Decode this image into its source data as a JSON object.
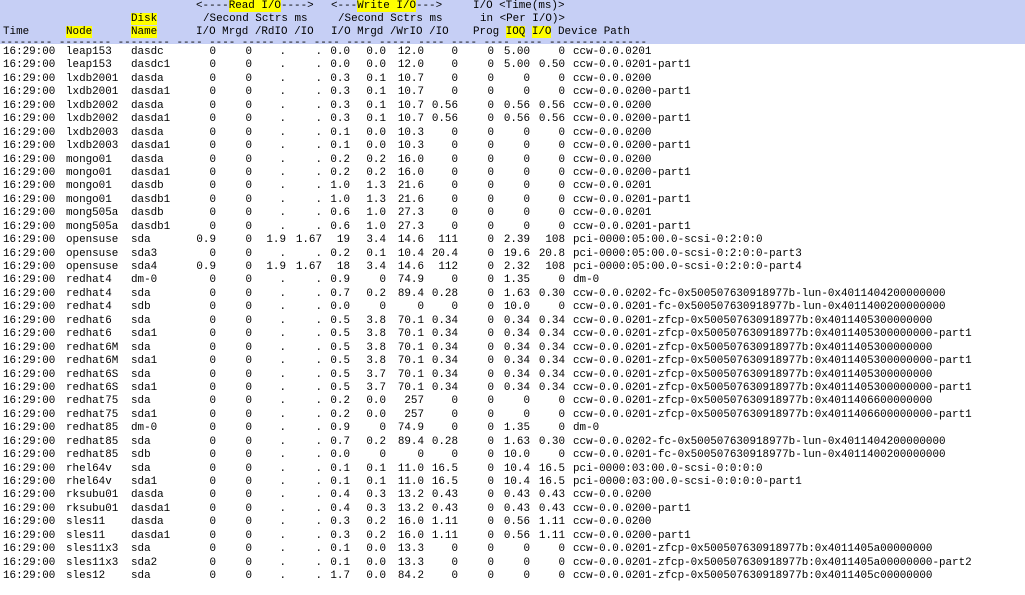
{
  "header": {
    "group_read": "<-----Read I/O---->",
    "group_read_hl": "Read I/O",
    "group_write": "<---Write I/O---->",
    "group_write_hl": "Write I/O",
    "group_time": "I/O <Time(ms)>",
    "group_time_sub": "in <Per I/O)>",
    "per_second_read": "/Second Sctrs ms",
    "per_second_write": "/Second Sctrs ms",
    "columns": {
      "time": "Time",
      "node": "Node",
      "disk_line1": "Disk",
      "disk_line2": "Name",
      "rio": "I/O",
      "rmrgd": "Mrgd",
      "rdio": "/RdIO",
      "rio2": "/IO",
      "wio": "I/O",
      "wmrgd": "Mrgd",
      "wrio": "/WrIO",
      "wio2": "/IO",
      "prog": "Prog",
      "ioq": "IOQ",
      "io": "I/O",
      "device": "Device Path"
    }
  },
  "rows": [
    [
      "16:29:00",
      "leap153",
      "dasdc",
      "0",
      "0",
      ".",
      ".",
      "0.0",
      "0.0",
      "12.0",
      "0",
      "0",
      "5.00",
      "0",
      "ccw-0.0.0201"
    ],
    [
      "16:29:00",
      "leap153",
      "dasdc1",
      "0",
      "0",
      ".",
      ".",
      "0.0",
      "0.0",
      "12.0",
      "0",
      "0",
      "5.00",
      "0.50",
      "ccw-0.0.0201-part1"
    ],
    [
      "16:29:00",
      "lxdb2001",
      "dasda",
      "0",
      "0",
      ".",
      ".",
      "0.3",
      "0.1",
      "10.7",
      "0",
      "0",
      "0",
      "0",
      "ccw-0.0.0200"
    ],
    [
      "16:29:00",
      "lxdb2001",
      "dasda1",
      "0",
      "0",
      ".",
      ".",
      "0.3",
      "0.1",
      "10.7",
      "0",
      "0",
      "0",
      "0",
      "ccw-0.0.0200-part1"
    ],
    [
      "16:29:00",
      "lxdb2002",
      "dasda",
      "0",
      "0",
      ".",
      ".",
      "0.3",
      "0.1",
      "10.7",
      "0.56",
      "0",
      "0.56",
      "0.56",
      "ccw-0.0.0200"
    ],
    [
      "16:29:00",
      "lxdb2002",
      "dasda1",
      "0",
      "0",
      ".",
      ".",
      "0.3",
      "0.1",
      "10.7",
      "0.56",
      "0",
      "0.56",
      "0.56",
      "ccw-0.0.0200-part1"
    ],
    [
      "16:29:00",
      "lxdb2003",
      "dasda",
      "0",
      "0",
      ".",
      ".",
      "0.1",
      "0.0",
      "10.3",
      "0",
      "0",
      "0",
      "0",
      "ccw-0.0.0200"
    ],
    [
      "16:29:00",
      "lxdb2003",
      "dasda1",
      "0",
      "0",
      ".",
      ".",
      "0.1",
      "0.0",
      "10.3",
      "0",
      "0",
      "0",
      "0",
      "ccw-0.0.0200-part1"
    ],
    [
      "16:29:00",
      "mongo01",
      "dasda",
      "0",
      "0",
      ".",
      ".",
      "0.2",
      "0.2",
      "16.0",
      "0",
      "0",
      "0",
      "0",
      "ccw-0.0.0200"
    ],
    [
      "16:29:00",
      "mongo01",
      "dasda1",
      "0",
      "0",
      ".",
      ".",
      "0.2",
      "0.2",
      "16.0",
      "0",
      "0",
      "0",
      "0",
      "ccw-0.0.0200-part1"
    ],
    [
      "16:29:00",
      "mongo01",
      "dasdb",
      "0",
      "0",
      ".",
      ".",
      "1.0",
      "1.3",
      "21.6",
      "0",
      "0",
      "0",
      "0",
      "ccw-0.0.0201"
    ],
    [
      "16:29:00",
      "mongo01",
      "dasdb1",
      "0",
      "0",
      ".",
      ".",
      "1.0",
      "1.3",
      "21.6",
      "0",
      "0",
      "0",
      "0",
      "ccw-0.0.0201-part1"
    ],
    [
      "16:29:00",
      "mong505a",
      "dasdb",
      "0",
      "0",
      ".",
      ".",
      "0.6",
      "1.0",
      "27.3",
      "0",
      "0",
      "0",
      "0",
      "ccw-0.0.0201"
    ],
    [
      "16:29:00",
      "mong505a",
      "dasdb1",
      "0",
      "0",
      ".",
      ".",
      "0.6",
      "1.0",
      "27.3",
      "0",
      "0",
      "0",
      "0",
      "ccw-0.0.0201-part1"
    ],
    [
      "16:29:00",
      "opensuse",
      "sda",
      "0.9",
      "0",
      "1.9",
      "1.67",
      "19",
      "3.4",
      "14.6",
      "111",
      "0",
      "2.39",
      "108",
      "pci-0000:05:00.0-scsi-0:2:0:0"
    ],
    [
      "16:29:00",
      "opensuse",
      "sda3",
      "0",
      "0",
      ".",
      ".",
      "0.2",
      "0.1",
      "10.4",
      "20.4",
      "0",
      "19.6",
      "20.8",
      "pci-0000:05:00.0-scsi-0:2:0:0-part3"
    ],
    [
      "16:29:00",
      "opensuse",
      "sda4",
      "0.9",
      "0",
      "1.9",
      "1.67",
      "18",
      "3.4",
      "14.6",
      "112",
      "0",
      "2.32",
      "108",
      "pci-0000:05:00.0-scsi-0:2:0:0-part4"
    ],
    [
      "16:29:00",
      "redhat4",
      "dm-0",
      "0",
      "0",
      ".",
      ".",
      "0.9",
      "0",
      "74.9",
      "0",
      "0",
      "1.35",
      "0",
      "dm-0"
    ],
    [
      "16:29:00",
      "redhat4",
      "sda",
      "0",
      "0",
      ".",
      ".",
      "0.7",
      "0.2",
      "89.4",
      "0.28",
      "0",
      "1.63",
      "0.30",
      "ccw-0.0.0202-fc-0x500507630918977b-lun-0x4011404200000000"
    ],
    [
      "16:29:00",
      "redhat4",
      "sdb",
      "0",
      "0",
      ".",
      ".",
      "0.0",
      "0",
      "0",
      "0",
      "0",
      "10.0",
      "0",
      "ccw-0.0.0201-fc-0x500507630918977b-lun-0x4011400200000000"
    ],
    [
      "16:29:00",
      "redhat6",
      "sda",
      "0",
      "0",
      ".",
      ".",
      "0.5",
      "3.8",
      "70.1",
      "0.34",
      "0",
      "0.34",
      "0.34",
      "ccw-0.0.0201-zfcp-0x500507630918977b:0x4011405300000000"
    ],
    [
      "16:29:00",
      "redhat6",
      "sda1",
      "0",
      "0",
      ".",
      ".",
      "0.5",
      "3.8",
      "70.1",
      "0.34",
      "0",
      "0.34",
      "0.34",
      "ccw-0.0.0201-zfcp-0x500507630918977b:0x4011405300000000-part1"
    ],
    [
      "16:29:00",
      "redhat6M",
      "sda",
      "0",
      "0",
      ".",
      ".",
      "0.5",
      "3.8",
      "70.1",
      "0.34",
      "0",
      "0.34",
      "0.34",
      "ccw-0.0.0201-zfcp-0x500507630918977b:0x4011405300000000"
    ],
    [
      "16:29:00",
      "redhat6M",
      "sda1",
      "0",
      "0",
      ".",
      ".",
      "0.5",
      "3.8",
      "70.1",
      "0.34",
      "0",
      "0.34",
      "0.34",
      "ccw-0.0.0201-zfcp-0x500507630918977b:0x4011405300000000-part1"
    ],
    [
      "16:29:00",
      "redhat6S",
      "sda",
      "0",
      "0",
      ".",
      ".",
      "0.5",
      "3.7",
      "70.1",
      "0.34",
      "0",
      "0.34",
      "0.34",
      "ccw-0.0.0201-zfcp-0x500507630918977b:0x4011405300000000"
    ],
    [
      "16:29:00",
      "redhat6S",
      "sda1",
      "0",
      "0",
      ".",
      ".",
      "0.5",
      "3.7",
      "70.1",
      "0.34",
      "0",
      "0.34",
      "0.34",
      "ccw-0.0.0201-zfcp-0x500507630918977b:0x4011405300000000-part1"
    ],
    [
      "16:29:00",
      "redhat75",
      "sda",
      "0",
      "0",
      ".",
      ".",
      "0.2",
      "0.0",
      "257",
      "0",
      "0",
      "0",
      "0",
      "ccw-0.0.0201-zfcp-0x500507630918977b:0x4011406600000000"
    ],
    [
      "16:29:00",
      "redhat75",
      "sda1",
      "0",
      "0",
      ".",
      ".",
      "0.2",
      "0.0",
      "257",
      "0",
      "0",
      "0",
      "0",
      "ccw-0.0.0201-zfcp-0x500507630918977b:0x4011406600000000-part1"
    ],
    [
      "16:29:00",
      "redhat85",
      "dm-0",
      "0",
      "0",
      ".",
      ".",
      "0.9",
      "0",
      "74.9",
      "0",
      "0",
      "1.35",
      "0",
      "dm-0"
    ],
    [
      "16:29:00",
      "redhat85",
      "sda",
      "0",
      "0",
      ".",
      ".",
      "0.7",
      "0.2",
      "89.4",
      "0.28",
      "0",
      "1.63",
      "0.30",
      "ccw-0.0.0202-fc-0x500507630918977b-lun-0x4011404200000000"
    ],
    [
      "16:29:00",
      "redhat85",
      "sdb",
      "0",
      "0",
      ".",
      ".",
      "0.0",
      "0",
      "0",
      "0",
      "0",
      "10.0",
      "0",
      "ccw-0.0.0201-fc-0x500507630918977b-lun-0x4011400200000000"
    ],
    [
      "16:29:00",
      "rhel64v",
      "sda",
      "0",
      "0",
      ".",
      ".",
      "0.1",
      "0.1",
      "11.0",
      "16.5",
      "0",
      "10.4",
      "16.5",
      "pci-0000:03:00.0-scsi-0:0:0:0"
    ],
    [
      "16:29:00",
      "rhel64v",
      "sda1",
      "0",
      "0",
      ".",
      ".",
      "0.1",
      "0.1",
      "11.0",
      "16.5",
      "0",
      "10.4",
      "16.5",
      "pci-0000:03:00.0-scsi-0:0:0:0-part1"
    ],
    [
      "16:29:00",
      "rksubu01",
      "dasda",
      "0",
      "0",
      ".",
      ".",
      "0.4",
      "0.3",
      "13.2",
      "0.43",
      "0",
      "0.43",
      "0.43",
      "ccw-0.0.0200"
    ],
    [
      "16:29:00",
      "rksubu01",
      "dasda1",
      "0",
      "0",
      ".",
      ".",
      "0.4",
      "0.3",
      "13.2",
      "0.43",
      "0",
      "0.43",
      "0.43",
      "ccw-0.0.0200-part1"
    ],
    [
      "16:29:00",
      "sles11",
      "dasda",
      "0",
      "0",
      ".",
      ".",
      "0.3",
      "0.2",
      "16.0",
      "1.11",
      "0",
      "0.56",
      "1.11",
      "ccw-0.0.0200"
    ],
    [
      "16:29:00",
      "sles11",
      "dasda1",
      "0",
      "0",
      ".",
      ".",
      "0.3",
      "0.2",
      "16.0",
      "1.11",
      "0",
      "0.56",
      "1.11",
      "ccw-0.0.0200-part1"
    ],
    [
      "16:29:00",
      "sles11x3",
      "sda",
      "0",
      "0",
      ".",
      ".",
      "0.1",
      "0.0",
      "13.3",
      "0",
      "0",
      "0",
      "0",
      "ccw-0.0.0201-zfcp-0x500507630918977b:0x4011405a00000000"
    ],
    [
      "16:29:00",
      "sles11x3",
      "sda2",
      "0",
      "0",
      ".",
      ".",
      "0.1",
      "0.0",
      "13.3",
      "0",
      "0",
      "0",
      "0",
      "ccw-0.0.0201-zfcp-0x500507630918977b:0x4011405a00000000-part2"
    ],
    [
      "16:29:00",
      "sles12",
      "sda",
      "0",
      "0",
      ".",
      ".",
      "1.7",
      "0.0",
      "84.2",
      "0",
      "0",
      "0",
      "0",
      "ccw-0.0.0201-zfcp-0x500507630918977b:0x4011405c00000000"
    ]
  ],
  "colors": {
    "header_bg": "#c6cff5",
    "highlight": "#ffff00"
  }
}
